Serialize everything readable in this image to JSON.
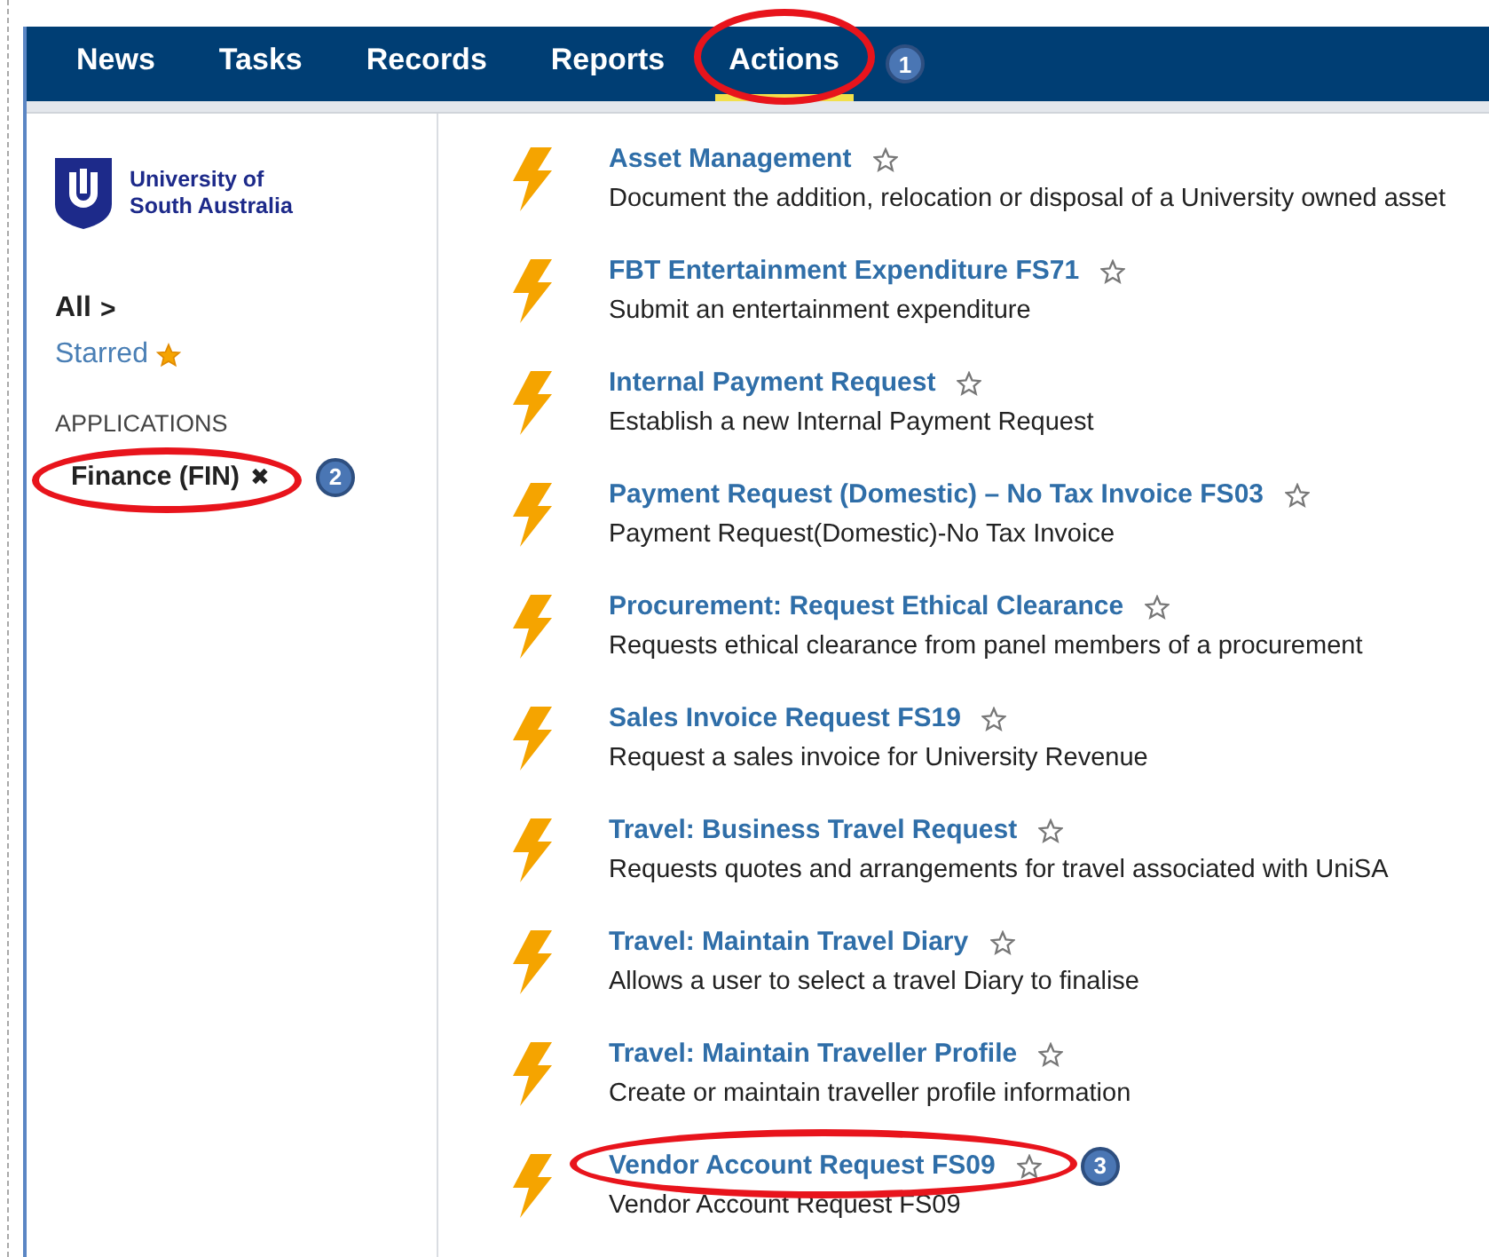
{
  "nav": {
    "tabs": [
      {
        "label": "News",
        "selected": false
      },
      {
        "label": "Tasks",
        "selected": false
      },
      {
        "label": "Records",
        "selected": false
      },
      {
        "label": "Reports",
        "selected": false
      },
      {
        "label": "Actions",
        "selected": true,
        "callout": "1"
      }
    ]
  },
  "sidebar": {
    "logo": [
      "University of",
      "South Australia"
    ],
    "filters": [
      {
        "kind": "all",
        "label": "All",
        "chevron": ">"
      },
      {
        "kind": "starred",
        "label": "Starred"
      }
    ],
    "section_heading": "APPLICATIONS",
    "applications": [
      {
        "label": "Finance (FIN)",
        "remove": "✖",
        "callout": "2"
      }
    ]
  },
  "actions": [
    {
      "title": "Asset Management",
      "description": "Document the addition, relocation or disposal of a University owned asset",
      "starred": false
    },
    {
      "title": "FBT Entertainment Expenditure FS71",
      "description": "Submit an entertainment expenditure",
      "starred": false
    },
    {
      "title": "Internal Payment Request",
      "description": "Establish a new Internal Payment Request",
      "starred": false
    },
    {
      "title": "Payment Request (Domestic) – No Tax Invoice FS03",
      "description": "Payment Request(Domestic)-No Tax Invoice",
      "starred": false
    },
    {
      "title": "Procurement: Request Ethical Clearance",
      "description": "Requests ethical clearance from panel members of a procurement",
      "starred": false
    },
    {
      "title": "Sales Invoice Request FS19",
      "description": "Request a sales invoice for University Revenue",
      "starred": false
    },
    {
      "title": "Travel: Business Travel Request",
      "description": "Requests quotes and arrangements for travel associated with UniSA",
      "starred": false
    },
    {
      "title": "Travel: Maintain Travel Diary",
      "description": "Allows a user to select a travel Diary to finalise",
      "starred": false
    },
    {
      "title": "Travel: Maintain Traveller Profile",
      "description": "Create or maintain traveller profile information",
      "starred": false
    },
    {
      "title": "Vendor Account Request FS09",
      "description": "Vendor Account Request FS09",
      "starred": false,
      "callout": "3"
    }
  ]
}
